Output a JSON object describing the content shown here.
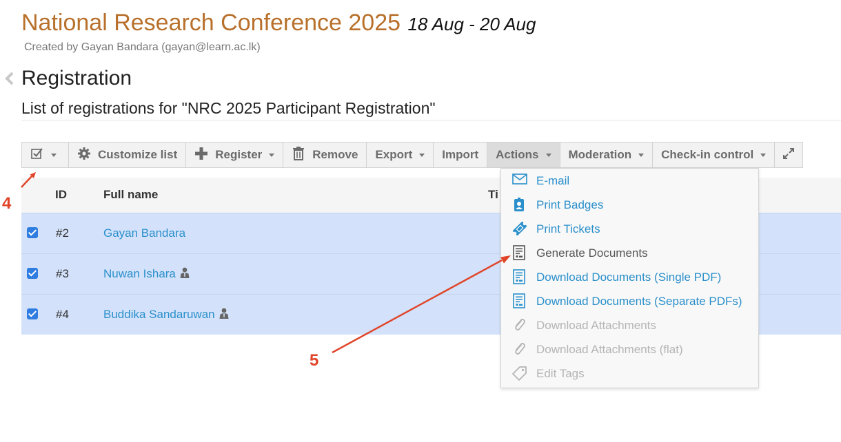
{
  "header": {
    "title": "National Research Conference 2025",
    "dates": "18 Aug - 20 Aug",
    "creator": "Created by Gayan Bandara (gayan@learn.ac.lk)"
  },
  "page": {
    "title": "Registration",
    "subtitle": "List of registrations for \"NRC 2025 Participant Registration\""
  },
  "toolbar": {
    "customize_label": "Customize list",
    "register_label": "Register",
    "remove_label": "Remove",
    "export_label": "Export",
    "import_label": "Import",
    "actions_label": "Actions",
    "moderation_label": "Moderation",
    "checkin_label": "Check-in control"
  },
  "table": {
    "columns": [
      "ID",
      "Full name",
      "Ti"
    ],
    "rows": [
      {
        "id": "#2",
        "name": "Gayan Bandara",
        "checked": true
      },
      {
        "id": "#3",
        "name": "Nuwan Ishara",
        "checked": true
      },
      {
        "id": "#4",
        "name": "Buddika Sandaruwan",
        "checked": true
      }
    ]
  },
  "actions_menu": {
    "items": [
      {
        "label": "E-mail",
        "icon": "envelope-icon",
        "state": "enabled"
      },
      {
        "label": "Print Badges",
        "icon": "badge-icon",
        "state": "enabled"
      },
      {
        "label": "Print Tickets",
        "icon": "ticket-icon",
        "state": "enabled"
      },
      {
        "label": "Generate Documents",
        "icon": "document-icon",
        "state": "highlighted"
      },
      {
        "label": "Download Documents (Single PDF)",
        "icon": "document-icon",
        "state": "enabled"
      },
      {
        "label": "Download Documents (Separate PDFs)",
        "icon": "document-icon",
        "state": "enabled"
      },
      {
        "label": "Download Attachments",
        "icon": "paperclip-icon",
        "state": "disabled"
      },
      {
        "label": "Download Attachments (flat)",
        "icon": "paperclip-icon",
        "state": "disabled"
      },
      {
        "label": "Edit Tags",
        "icon": "tag-icon",
        "state": "disabled"
      }
    ]
  },
  "annotations": {
    "step4": "4",
    "step5": "5"
  },
  "colors": {
    "accent": "#2a8fcb",
    "title": "#b8702b",
    "selected_row": "#d3e2fa",
    "annotation": "#e0452a"
  }
}
